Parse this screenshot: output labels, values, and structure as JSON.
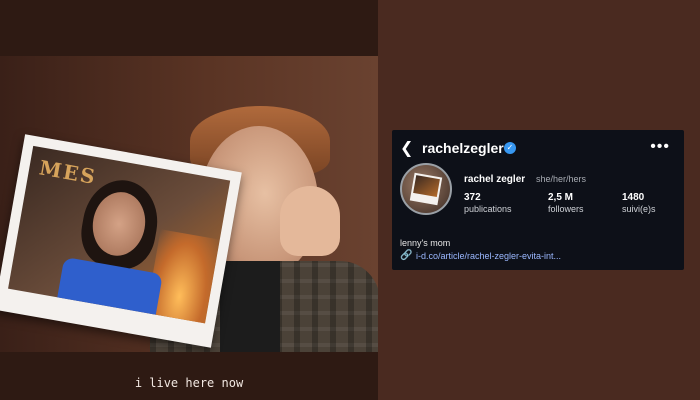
{
  "story": {
    "caption": "i live here now",
    "polaroid_text": "MES"
  },
  "instagram": {
    "username": "rachelzegler",
    "display_name": "rachel zegler",
    "pronouns": "she/her/hers",
    "stats": [
      {
        "value": "372",
        "label": "publications"
      },
      {
        "value": "2,5 M",
        "label": "followers"
      },
      {
        "value": "1480",
        "label": "suivi(e)s"
      }
    ],
    "bio": "lenny's mom",
    "link": "i-d.co/article/rachel-zegler-evita-int..."
  },
  "icons": {
    "back": "chevron-left-icon",
    "verified": "verified-badge-icon",
    "more": "more-options-icon",
    "link": "link-icon"
  },
  "colors": {
    "background": "#4a2a20",
    "card": "#0d1018",
    "verified": "#3797f0",
    "link": "#9bb8ff"
  }
}
